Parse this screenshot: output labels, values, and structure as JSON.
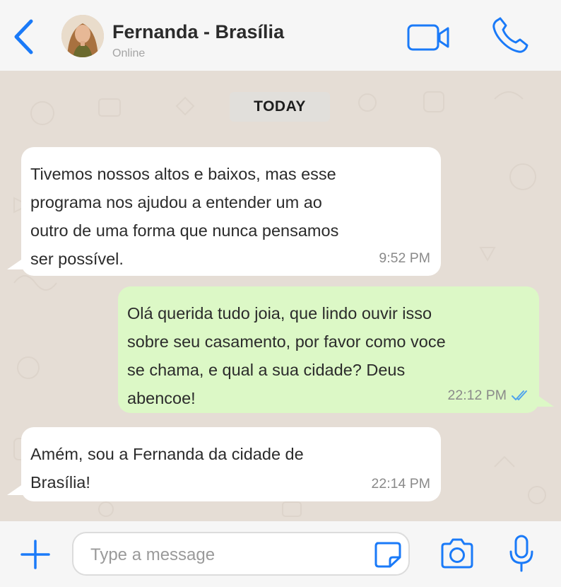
{
  "header": {
    "contact_name": "Fernanda - Brasília",
    "status": "Online",
    "back_icon": "chevron-left-icon",
    "video_icon": "video-camera-icon",
    "call_icon": "phone-icon"
  },
  "chat": {
    "date_label": "TODAY",
    "messages": [
      {
        "direction": "incoming",
        "text": "Tivemos nossos altos e baixos, mas esse\nprograma nos ajudou a entender um ao\noutro de uma forma que nunca pensamos\nser possível.",
        "time": "9:52 PM"
      },
      {
        "direction": "outgoing",
        "text": "Olá querida tudo joia, que lindo ouvir isso\nsobre seu casamento, por favor como voce\nse chama, e qual a sua cidade? Deus\nabencoe!",
        "time": "22:12 PM",
        "status": "read"
      },
      {
        "direction": "incoming",
        "text": "Amém, sou a Fernanda da cidade de\nBrasília!",
        "time": "22:14 PM"
      }
    ]
  },
  "composer": {
    "placeholder": "Type a message",
    "value": ""
  },
  "colors": {
    "accent": "#1a7af8",
    "incoming_bubble": "#ffffff",
    "outgoing_bubble": "#dcf8c6",
    "chat_background": "#e5ddd5",
    "read_ticks": "#4fa3ec"
  }
}
